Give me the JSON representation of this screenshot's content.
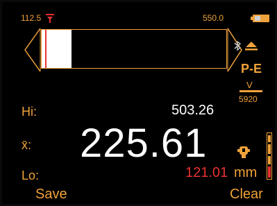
{
  "range": {
    "min_label": "112.5",
    "max_label": "550.0"
  },
  "gauge": {
    "fill_fraction": 0.16,
    "marker_fraction": 0.02
  },
  "readings": {
    "hi_label": "Hi:",
    "hi_value": "503.26",
    "mean_label": "x̄:",
    "mean_value": "225.61",
    "lo_label": "Lo:",
    "lo_value": "121.01",
    "unit": "mm"
  },
  "mode": {
    "name": "P-E",
    "sub": "V",
    "count": "5920"
  },
  "softkeys": {
    "left": "Save",
    "right": "Clear"
  },
  "icons": [
    "limit-marker-icon",
    "battery-icon",
    "bluetooth-icon",
    "eject-icon",
    "probe-icon",
    "signal-level-icon"
  ],
  "colors": {
    "accent": "#f0a23a",
    "alarm": "#e83232",
    "text": "#ffffff"
  }
}
